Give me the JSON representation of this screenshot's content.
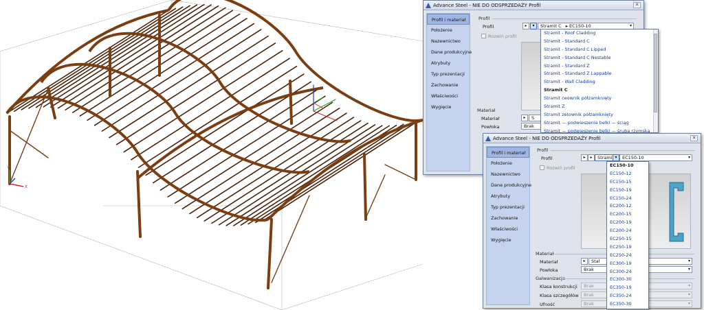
{
  "viewport": {
    "ucs_axes": {
      "x": "X",
      "y": "Y"
    }
  },
  "dialog_back": {
    "title": "Advance Steel - NIE DO ODSPRZEDAŻY   Profil",
    "sidebar": [
      "Profil i materiał",
      "Położenie",
      "Nazewnictwo",
      "Dane produkcyjne",
      "Atrybuty",
      "Typ prezentacji",
      "Zachowanie",
      "Właściwości",
      "Wygięcie"
    ],
    "active_tab": "Profil i materiał",
    "section_profile": "Profil",
    "profile_label": "Profil",
    "family_value": "Stramit C",
    "size_value": "EC150-10",
    "unfold_label": "Rozwiń profil",
    "section_material": "Materiał",
    "material_label": "Materiał",
    "material_value": "S",
    "coating_label": "Powłoka",
    "coating_value": "Brak",
    "family_options": [
      "Stramit - Roof Cladding",
      "Stramit - Standard C",
      "Stramit - Standard C Lipped",
      "Stramit - Standard C Nestable",
      "Stramit - Standard Z",
      "Stramit - Standard Z Lappable",
      "Stramit - Wall Cladding",
      "Stramit C",
      "Stramit ceownik półzamknięty",
      "Stramit Z",
      "Stramit zetownik półzamknięty",
      "Stramit — podwieszenie belki — ściąg",
      "Stramit — podwieszenie belki — śruba rzymska"
    ],
    "family_selected": "Stramit C"
  },
  "dialog_front": {
    "title": "Advance Steel - NIE DO ODSPRZEDAŻY   Profil",
    "sidebar": [
      "Profil i materiał",
      "Położenie",
      "Nazewnictwo",
      "Dane produkcyjne",
      "Atrybuty",
      "Typ prezentacji",
      "Zachowanie",
      "Właściwości",
      "Wygięcie"
    ],
    "active_tab": "Profil i materiał",
    "section_profile": "Profil",
    "profile_label": "Profil",
    "family_value": "Stramit C",
    "size_value": "EC150-10",
    "unfold_label": "Rozwiń profil",
    "section_material": "Materiał",
    "material_label": "Materiał",
    "material_value": "Stal",
    "coating_label": "Powłoka",
    "coating_value": "Brak",
    "section_galv": "Galwanizacja",
    "class_construction_label": "Klasa konstrukcji",
    "class_construction_value": "Brak",
    "class_detail_label": "Klasa szczegółów",
    "class_detail_value": "Brak",
    "confidence_label": "Ufność",
    "confidence_value": "Brak",
    "size_options": [
      "EC150-10",
      "EC150-12",
      "EC150-15",
      "EC150-19",
      "EC150-24",
      "EC200-12",
      "EC200-15",
      "EC200-19",
      "EC200-24",
      "EC250-15",
      "EC250-19",
      "EC250-24",
      "EC300-19",
      "EC300-24",
      "EC300-30",
      "EC350-19",
      "EC350-24",
      "EC350-30"
    ],
    "size_selected": "EC150-10"
  },
  "colors": {
    "steel": "#7a3e12",
    "steel_dark": "#4a220a",
    "sidebar": "#c6d3ee",
    "dialog_bg": "#dfe4ec",
    "list_text": "#1a3e8a"
  }
}
